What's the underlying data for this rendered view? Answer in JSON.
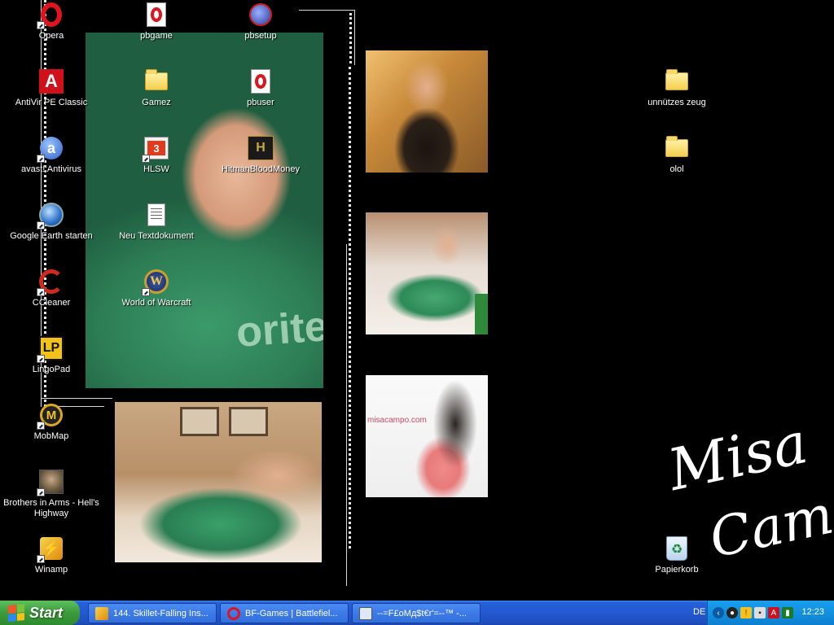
{
  "desktop": {
    "icons": [
      {
        "id": "opera",
        "label": "Opera",
        "glyph": "opera-icon",
        "shortcut": true
      },
      {
        "id": "pbgame",
        "label": "pbgame",
        "glyph": "opera-document-icon",
        "shortcut": false
      },
      {
        "id": "pbsetup",
        "label": "pbsetup",
        "glyph": "setup-icon",
        "shortcut": false
      },
      {
        "id": "antivir",
        "label": "AntiVir PE Classic",
        "glyph": "avira-umbrella-icon",
        "shortcut": false
      },
      {
        "id": "gamez",
        "label": "Gamez",
        "glyph": "folder-icon",
        "shortcut": false
      },
      {
        "id": "pbuser",
        "label": "pbuser",
        "glyph": "opera-document-icon",
        "shortcut": false
      },
      {
        "id": "avast",
        "label": "avast! Antivirus",
        "glyph": "avast-icon",
        "shortcut": true
      },
      {
        "id": "hlsw",
        "label": "HLSW",
        "glyph": "hlsw-icon",
        "shortcut": true
      },
      {
        "id": "hitman",
        "label": "HitmanBloodMoney",
        "glyph": "hitman-icon",
        "shortcut": false
      },
      {
        "id": "google-earth",
        "label": "Google Earth starten",
        "glyph": "google-earth-icon",
        "shortcut": true
      },
      {
        "id": "neu-text",
        "label": "Neu Textdokument",
        "glyph": "text-document-icon",
        "shortcut": false
      },
      {
        "id": "ccleaner",
        "label": "CCleaner",
        "glyph": "ccleaner-icon",
        "shortcut": true
      },
      {
        "id": "wow",
        "label": "World of Warcraft",
        "glyph": "world-of-warcraft-icon",
        "shortcut": true
      },
      {
        "id": "lingopad",
        "label": "LingoPad",
        "glyph": "lingopad-icon",
        "shortcut": true
      },
      {
        "id": "mobmap",
        "label": "MobMap",
        "glyph": "mobmap-icon",
        "shortcut": true
      },
      {
        "id": "brothers",
        "label": "Brothers in Arms - Hell's Highway",
        "glyph": "soldier-icon",
        "shortcut": true
      },
      {
        "id": "winamp",
        "label": "Winamp",
        "glyph": "winamp-icon",
        "shortcut": true
      },
      {
        "id": "unnuetzes",
        "label": "unnützes zeug",
        "glyph": "folder-icon",
        "shortcut": false
      },
      {
        "id": "olol",
        "label": "olol",
        "glyph": "folder-icon",
        "shortcut": false
      },
      {
        "id": "papierkorb",
        "label": "Papierkorb",
        "glyph": "recycle-bin-icon",
        "shortcut": false
      }
    ],
    "wallpaper": {
      "signature_line1": "Misa",
      "signature_line2": "Campo",
      "website_text": "misacampo.com",
      "shirt_text": "orite"
    }
  },
  "taskbar": {
    "start_label": "Start",
    "tasks": [
      {
        "label": "144. Skillet-Falling Ins...",
        "glyph": "winamp-icon",
        "color": "#f0b020"
      },
      {
        "label": "BF-Games | Battlefiel...",
        "glyph": "opera-icon",
        "color": "#e0141e"
      },
      {
        "label": "--=F£oMд$t€r'=--™ -...",
        "glyph": "chat-window-icon",
        "color": "#dfe8f6"
      }
    ],
    "tray": {
      "language": "DE",
      "clock": "12:23",
      "icons": [
        "expand-arrow-icon",
        "steam-icon",
        "security-shield-icon",
        "network-icon",
        "avira-umbrella-icon",
        "monitor-icon"
      ]
    }
  },
  "colors": {
    "taskbar_blue": "#2458d0",
    "start_green": "#3c9a3c",
    "tray_blue": "#1290e0"
  }
}
